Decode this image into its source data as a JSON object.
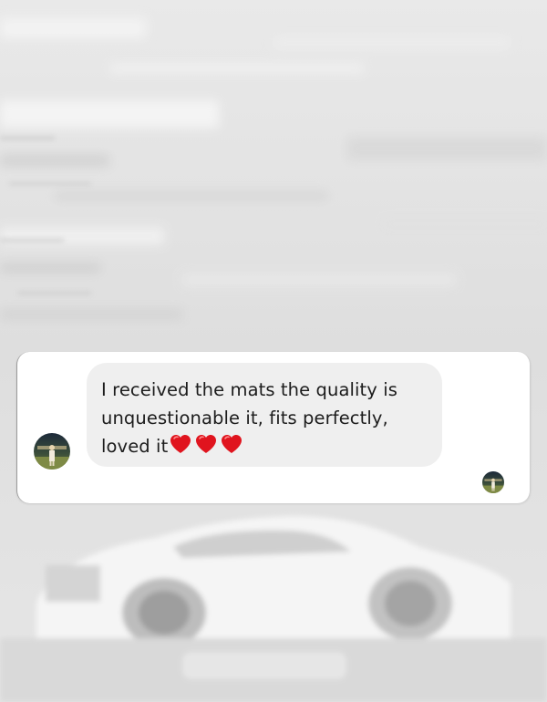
{
  "conversation": {
    "message": {
      "line1": "I received the mats the quality is",
      "line2": "unquestionable it, fits perfectly,",
      "line3": "loved it",
      "reaction_icons": [
        "heart-emoji",
        "heart-emoji",
        "heart-emoji"
      ]
    },
    "sender_avatar": "avatar",
    "seen_avatar": "avatar"
  },
  "colors": {
    "background": "#e4e4e4",
    "card": "#ffffff",
    "bubble": "#efefef",
    "text": "#1c1c1c",
    "heart": "#e0141e"
  }
}
